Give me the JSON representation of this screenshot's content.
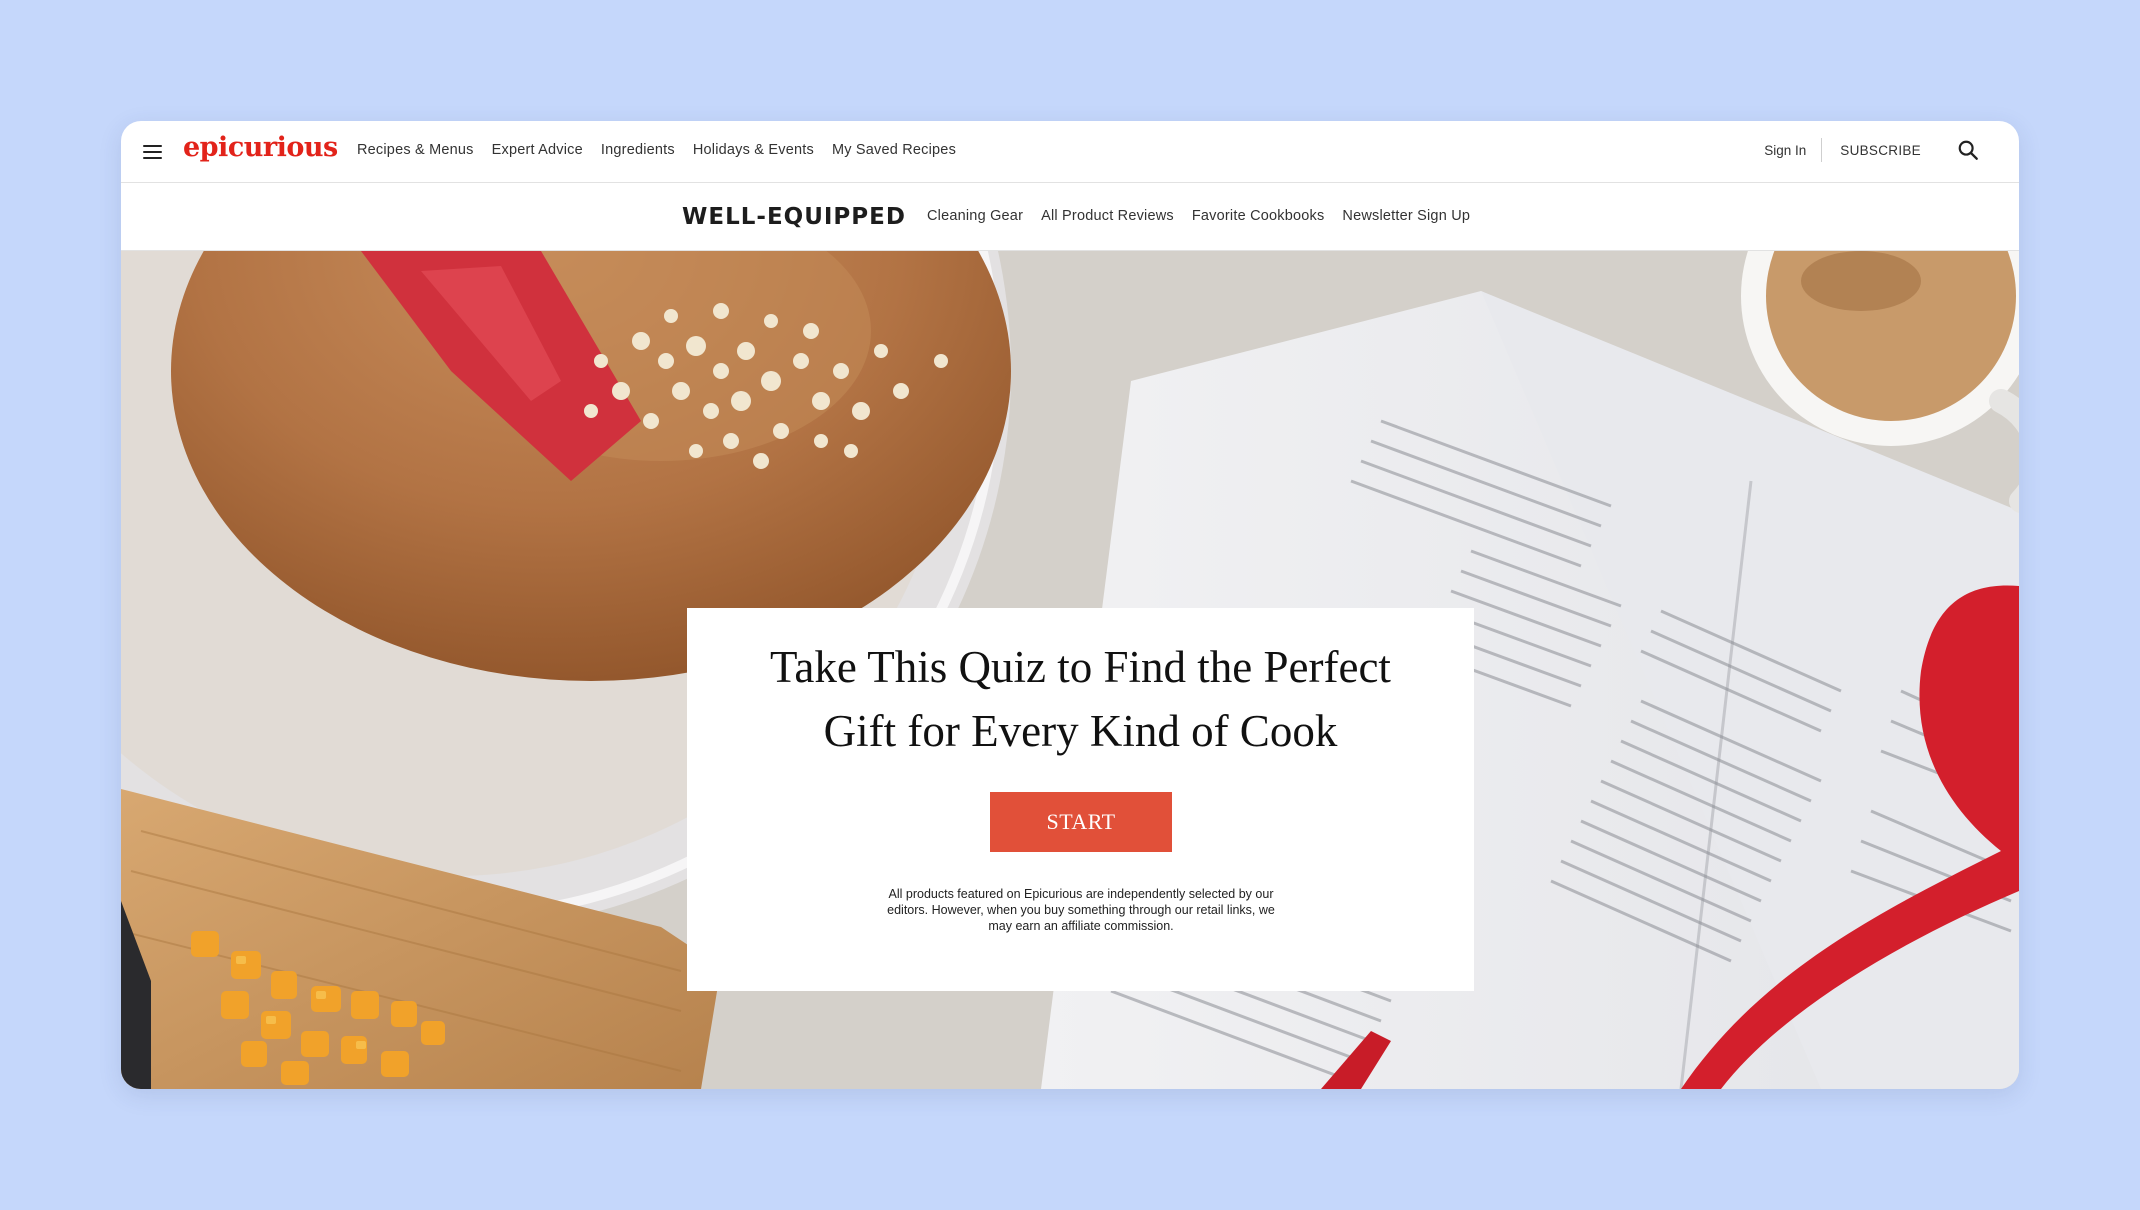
{
  "brand": {
    "logo_text": "epicurious",
    "logo_color": "#e2231a"
  },
  "topnav": {
    "links": [
      "Recipes & Menus",
      "Expert Advice",
      "Ingredients",
      "Holidays & Events",
      "My Saved Recipes"
    ],
    "sign_in": "Sign In",
    "subscribe": "SUBSCRIBE",
    "menu_icon": "hamburger-menu-icon",
    "search_icon": "search-icon"
  },
  "subnav": {
    "section_logo": "WELL-EQUIPPED",
    "links": [
      "Cleaning Gear",
      "All Product Reviews",
      "Favorite Cookbooks",
      "Newsletter Sign Up"
    ]
  },
  "quiz": {
    "title": "Take This Quiz to Find the Perfect Gift for Every Kind of Cook",
    "start_label": "START",
    "button_color": "#e15039",
    "disclaimer": "All products featured on Epicurious are independently selected by our editors. However, when you buy something through our retail links, we may earn an affiliate commission."
  },
  "colors": {
    "page_background": "#c5d7fb",
    "accent": "#e2231a"
  }
}
